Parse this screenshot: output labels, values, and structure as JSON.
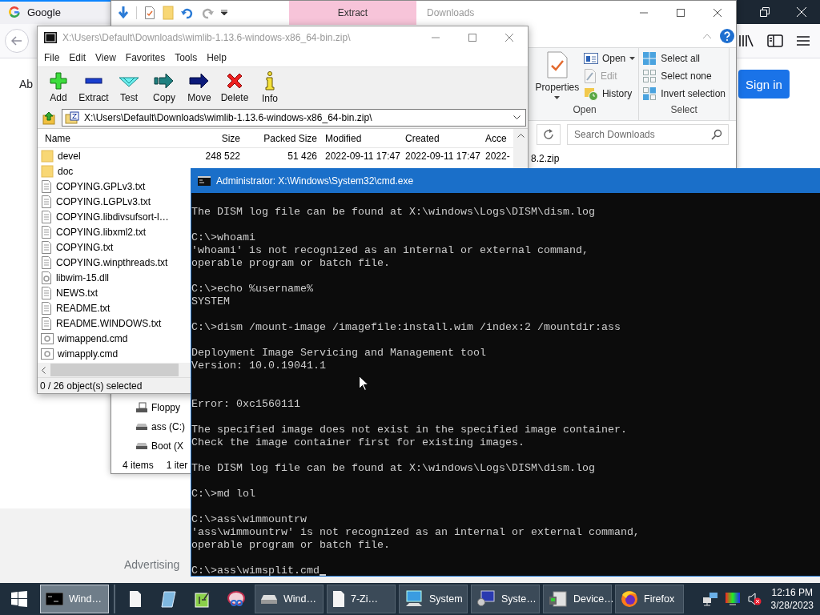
{
  "browser": {
    "tab": {
      "title": "Google",
      "selected": true
    },
    "page_link": "Ab",
    "sign_in": "Sign in",
    "footer_link": "Advertising"
  },
  "explorer": {
    "contextual_tab": "Extract",
    "title": "Downloads",
    "ribbon_groups": [
      {
        "label": "Open",
        "items": [
          {
            "label": "Properties",
            "kind": "properties",
            "disabled": false
          },
          {
            "label": "Open",
            "kind": "open",
            "disabled": false
          },
          {
            "label": "Edit",
            "kind": "edit",
            "disabled": true
          },
          {
            "label": "History",
            "kind": "history",
            "disabled": false
          }
        ]
      },
      {
        "label": "Select",
        "items": [
          {
            "label": "Select all",
            "kind": "all",
            "disabled": false
          },
          {
            "label": "Select none",
            "kind": "none",
            "disabled": false
          },
          {
            "label": "Invert selection",
            "kind": "invert",
            "disabled": false
          }
        ]
      }
    ],
    "search": {
      "placeholder": "Search Downloads"
    },
    "file_partial": "8.2.zip",
    "nav_items": [
      {
        "label": "Floppy",
        "kind": "floppy"
      },
      {
        "label": "ass (C:)",
        "kind": "drive"
      },
      {
        "label": "Boot (X",
        "kind": "drive"
      }
    ],
    "status": {
      "count": "4 items",
      "selection": "1 iter"
    }
  },
  "archiver": {
    "title": "X:\\Users\\Default\\Downloads\\wimlib-1.13.6-windows-x86_64-bin.zip\\",
    "menu": [
      "File",
      "Edit",
      "View",
      "Favorites",
      "Tools",
      "Help"
    ],
    "toolbar": [
      {
        "label": "Add",
        "kind": "add"
      },
      {
        "label": "Extract",
        "kind": "extract"
      },
      {
        "label": "Test",
        "kind": "test"
      },
      {
        "label": "Copy",
        "kind": "copy"
      },
      {
        "label": "Move",
        "kind": "move"
      },
      {
        "label": "Delete",
        "kind": "delete"
      },
      {
        "label": "Info",
        "kind": "info"
      }
    ],
    "path": "X:\\Users\\Default\\Downloads\\wimlib-1.13.6-windows-x86_64-bin.zip\\",
    "columns": [
      "Name",
      "Size",
      "Packed Size",
      "Modified",
      "Created",
      "Acce"
    ],
    "rows": [
      {
        "kind": "folder",
        "name": "devel",
        "size": "248 522",
        "packed_size": "51 426",
        "modified": "2022-09-11 17:47",
        "created": "2022-09-11 17:47",
        "accessed": "2022-"
      },
      {
        "kind": "folder",
        "name": "doc"
      },
      {
        "kind": "text",
        "name": "COPYING.GPLv3.txt"
      },
      {
        "kind": "text",
        "name": "COPYING.LGPLv3.txt"
      },
      {
        "kind": "text",
        "name": "COPYING.libdivsufsort-l…"
      },
      {
        "kind": "text",
        "name": "COPYING.libxml2.txt"
      },
      {
        "kind": "text",
        "name": "COPYING.txt"
      },
      {
        "kind": "text",
        "name": "COPYING.winpthreads.txt"
      },
      {
        "kind": "library",
        "name": "libwim-15.dll"
      },
      {
        "kind": "text",
        "name": "NEWS.txt"
      },
      {
        "kind": "text",
        "name": "README.txt"
      },
      {
        "kind": "text",
        "name": "README.WINDOWS.txt"
      },
      {
        "kind": "script",
        "name": "wimappend.cmd"
      },
      {
        "kind": "script",
        "name": "wimapply.cmd"
      }
    ],
    "status": "0 / 26 object(s) selected"
  },
  "console": {
    "title": "Administrator: X:\\Windows\\System32\\cmd.exe",
    "cursor": true,
    "blocks": [
      {
        "extra_gap": false,
        "lines": [
          "The DISM log file can be found at X:\\windows\\Logs\\DISM\\dism.log"
        ]
      },
      {
        "extra_gap": false,
        "lines": [
          "C:\\>whoami",
          "'whoami' is not recognized as an internal or external command,",
          "operable program or batch file."
        ]
      },
      {
        "extra_gap": false,
        "lines": [
          "C:\\>echo %username%",
          "SYSTEM"
        ]
      },
      {
        "extra_gap": false,
        "lines": [
          "C:\\>dism /mount-image /imagefile:install.wim /index:2 /mountdir:ass"
        ]
      },
      {
        "extra_gap": false,
        "lines": [
          "Deployment Image Servicing and Management tool",
          "Version: 10.0.19041.1"
        ]
      },
      {
        "extra_gap": true,
        "lines": [
          "Error: 0xc1560111"
        ]
      },
      {
        "extra_gap": false,
        "lines": [
          "The specified image does not exist in the specified image container.",
          "Check the image container first for existing images."
        ]
      },
      {
        "extra_gap": false,
        "lines": [
          "The DISM log file can be found at X:\\windows\\Logs\\DISM\\dism.log"
        ]
      },
      {
        "extra_gap": false,
        "lines": [
          "C:\\>md lol"
        ]
      },
      {
        "extra_gap": false,
        "lines": [
          "C:\\>ass\\wimmountrw",
          "'ass\\wimmountrw' is not recognized as an internal or external command,",
          "operable program or batch file."
        ]
      },
      {
        "extra_gap": false,
        "lines": [
          "C:\\>ass\\wimsplit.cmd"
        ]
      }
    ]
  },
  "taskbar": {
    "items": [
      {
        "kind": "console",
        "label": "Wind…",
        "selected": true
      },
      {
        "kind": "file",
        "selected": false
      },
      {
        "kind": "notepad",
        "selected": false
      },
      {
        "kind": "editor",
        "selected": false
      },
      {
        "kind": "snip",
        "selected": false
      },
      {
        "kind": "drive",
        "label": "Wind…",
        "selected": false
      },
      {
        "kind": "file",
        "label": "7-Zi…",
        "selected": false
      },
      {
        "kind": "system",
        "label": "System",
        "selected": false
      },
      {
        "kind": "settings",
        "label": "Syste…",
        "selected": false
      },
      {
        "kind": "device",
        "label": "Device…",
        "selected": false
      },
      {
        "kind": "browser",
        "label": "Firefox",
        "selected": false
      }
    ],
    "muted": true,
    "time": "12:16 PM",
    "date": "3/28/2023"
  }
}
